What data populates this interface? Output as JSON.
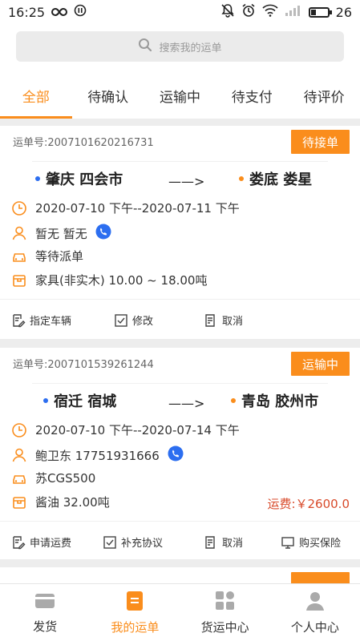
{
  "status_bar": {
    "time": "16:25",
    "battery": "26"
  },
  "search": {
    "placeholder": "搜索我的运单"
  },
  "tabs": [
    {
      "label": "全部",
      "active": true
    },
    {
      "label": "待确认",
      "active": false
    },
    {
      "label": "运输中",
      "active": false
    },
    {
      "label": "待支付",
      "active": false
    },
    {
      "label": "待评价",
      "active": false
    }
  ],
  "orders": [
    {
      "waybill": "运单号:2007101620216731",
      "status": "待接单",
      "from": "肇庆 四会市",
      "arrow": "——>",
      "to": "娄底 娄星",
      "time": "2020-07-10  下午--2020-07-11  下午",
      "driver": "暂无 暂无",
      "vehicle": "等待派单",
      "cargo": "家具(非实木)  10.00 ~ 18.00吨",
      "actions": [
        "指定车辆",
        "修改",
        "取消"
      ]
    },
    {
      "waybill": "运单号:2007101539261244",
      "status": "运输中",
      "from": "宿迁 宿城",
      "arrow": "——>",
      "to": "青岛 胶州市",
      "time": "2020-07-10  下午--2020-07-14  下午",
      "driver": "鲍卫东 17751931666",
      "vehicle": "苏CGS500",
      "cargo": "酱油   32.00吨",
      "fee": "运费:￥2600.0",
      "actions": [
        "申请运费",
        "补充协议",
        "取消",
        "购买保险"
      ]
    }
  ],
  "bottom_nav": [
    {
      "label": "发货",
      "active": false
    },
    {
      "label": "我的运单",
      "active": true
    },
    {
      "label": "货运中心",
      "active": false
    },
    {
      "label": "个人中心",
      "active": false
    }
  ],
  "colors": {
    "accent": "#fa8d1c",
    "blue": "#2c6ef0",
    "fee": "#d84a2a"
  }
}
